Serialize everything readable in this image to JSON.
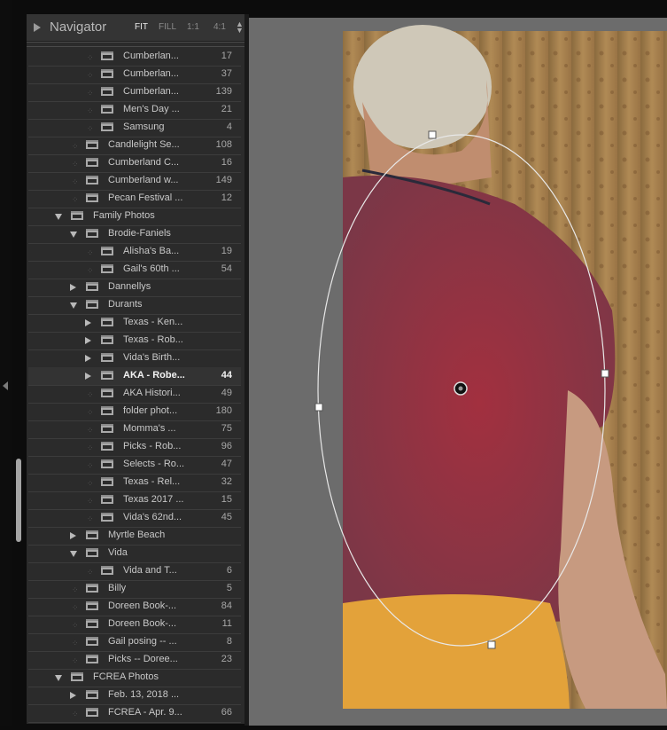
{
  "navigator": {
    "title": "Navigator",
    "zoom_options": [
      "FIT",
      "FILL",
      "1:1",
      "4:1"
    ],
    "active_zoom": "FIT"
  },
  "folders": [
    {
      "label": "Cumberlan...",
      "count": "17",
      "level": 2,
      "toggle": "none"
    },
    {
      "label": "Cumberlan...",
      "count": "37",
      "level": 2,
      "toggle": "none"
    },
    {
      "label": "Cumberlan...",
      "count": "139",
      "level": 2,
      "toggle": "none"
    },
    {
      "label": "Men's Day ...",
      "count": "21",
      "level": 2,
      "toggle": "none"
    },
    {
      "label": "Samsung",
      "count": "4",
      "level": 2,
      "toggle": "none"
    },
    {
      "label": "Candlelight Se...",
      "count": "108",
      "level": 1,
      "toggle": "none"
    },
    {
      "label": "Cumberland C...",
      "count": "16",
      "level": 1,
      "toggle": "none"
    },
    {
      "label": "Cumberland w...",
      "count": "149",
      "level": 1,
      "toggle": "none"
    },
    {
      "label": "Pecan Festival ...",
      "count": "12",
      "level": 1,
      "toggle": "none"
    },
    {
      "label": "Family Photos",
      "count": "",
      "level": 0,
      "toggle": "expanded"
    },
    {
      "label": "Brodie-Faniels",
      "count": "",
      "level": 1,
      "toggle": "expanded"
    },
    {
      "label": "Alisha's Ba...",
      "count": "19",
      "level": 2,
      "toggle": "none"
    },
    {
      "label": "Gail's 60th ...",
      "count": "54",
      "level": 2,
      "toggle": "none"
    },
    {
      "label": "Dannellys",
      "count": "",
      "level": 1,
      "toggle": "collapsed"
    },
    {
      "label": "Durants",
      "count": "",
      "level": 1,
      "toggle": "expanded"
    },
    {
      "label": "Texas - Ken...",
      "count": "",
      "level": 2,
      "toggle": "collapsed"
    },
    {
      "label": "Texas - Rob...",
      "count": "",
      "level": 2,
      "toggle": "collapsed"
    },
    {
      "label": "Vida's Birth...",
      "count": "",
      "level": 2,
      "toggle": "collapsed"
    },
    {
      "label": "AKA - Robe...",
      "count": "44",
      "level": 2,
      "toggle": "collapsed",
      "selected": true
    },
    {
      "label": "AKA Histori...",
      "count": "49",
      "level": 2,
      "toggle": "none"
    },
    {
      "label": "folder phot...",
      "count": "180",
      "level": 2,
      "toggle": "none"
    },
    {
      "label": "Momma's ...",
      "count": "75",
      "level": 2,
      "toggle": "none"
    },
    {
      "label": "Picks - Rob...",
      "count": "96",
      "level": 2,
      "toggle": "none"
    },
    {
      "label": "Selects - Ro...",
      "count": "47",
      "level": 2,
      "toggle": "none"
    },
    {
      "label": "Texas - Rel...",
      "count": "32",
      "level": 2,
      "toggle": "none"
    },
    {
      "label": "Texas 2017 ...",
      "count": "15",
      "level": 2,
      "toggle": "none"
    },
    {
      "label": "Vida's 62nd...",
      "count": "45",
      "level": 2,
      "toggle": "none"
    },
    {
      "label": "Myrtle Beach",
      "count": "",
      "level": 1,
      "toggle": "collapsed"
    },
    {
      "label": "Vida",
      "count": "",
      "level": 1,
      "toggle": "expanded"
    },
    {
      "label": "Vida and T...",
      "count": "6",
      "level": 2,
      "toggle": "none"
    },
    {
      "label": "Billy",
      "count": "5",
      "level": 1,
      "toggle": "none"
    },
    {
      "label": "Doreen Book-...",
      "count": "84",
      "level": 1,
      "toggle": "none"
    },
    {
      "label": "Doreen Book-...",
      "count": "11",
      "level": 1,
      "toggle": "none"
    },
    {
      "label": "Gail posing -- ...",
      "count": "8",
      "level": 1,
      "toggle": "none"
    },
    {
      "label": "Picks -- Doree...",
      "count": "23",
      "level": 1,
      "toggle": "none"
    },
    {
      "label": "FCREA Photos",
      "count": "",
      "level": 0,
      "toggle": "expanded"
    },
    {
      "label": "Feb. 13, 2018 ...",
      "count": "",
      "level": 1,
      "toggle": "collapsed"
    },
    {
      "label": "FCREA - Apr. 9...",
      "count": "66",
      "level": 1,
      "toggle": "none"
    }
  ],
  "colors": {
    "panel_bg": "#2b2b2b",
    "canvas_bg": "#6c6c6c",
    "mask_overlay": "#ffffff",
    "shirt": "#7a3440",
    "pants": "#e6a23a"
  }
}
